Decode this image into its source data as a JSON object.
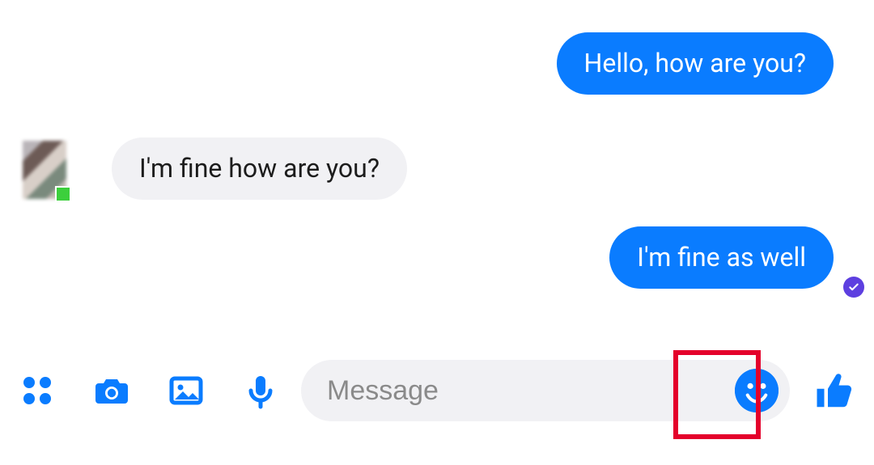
{
  "colors": {
    "accent": "#0a7cff",
    "sent_bubble": "#0a7cff",
    "received_bubble": "#f1f1f4",
    "delivered_badge": "#5d3fe0",
    "highlight": "#e4002b",
    "presence": "#3ccf3c"
  },
  "messages": {
    "m1": {
      "text": "Hello, how are you?",
      "side": "sent"
    },
    "m2": {
      "text": "I'm fine how are you?",
      "side": "received"
    },
    "m3": {
      "text": "I'm fine as well",
      "side": "sent",
      "delivered": true
    }
  },
  "composer": {
    "placeholder": "Message",
    "value": "",
    "icons": {
      "apps": "apps-icon",
      "camera": "camera-icon",
      "gallery": "gallery-icon",
      "mic": "mic-icon",
      "emoji": "smiley-icon",
      "like": "thumbs-up-icon"
    }
  }
}
